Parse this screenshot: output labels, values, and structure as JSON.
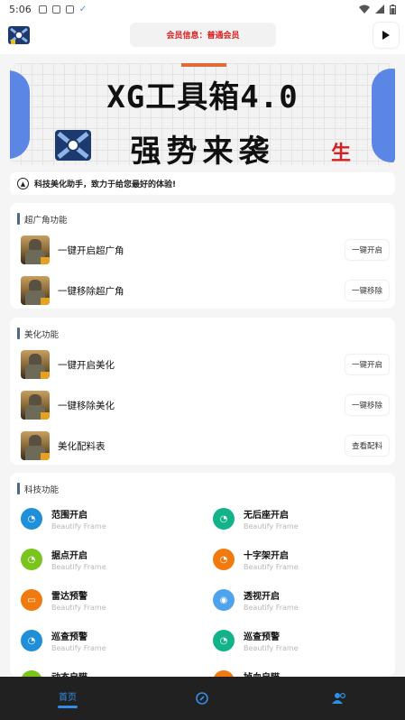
{
  "status_bar": {
    "time": "5:06"
  },
  "header": {
    "member_info": "会员信息：普通会员"
  },
  "banner": {
    "title": "XG工具箱4.0",
    "subtitle": "强势来袭",
    "corner_char": "生"
  },
  "notice": {
    "text": "科技美化助手，致力于给您最好的体验!"
  },
  "section1": {
    "title": "超广角功能",
    "rows": [
      {
        "label": "一键开启超广角",
        "action": "一键开启"
      },
      {
        "label": "一键移除超广角",
        "action": "一键移除"
      }
    ]
  },
  "section2": {
    "title": "美化功能",
    "rows": [
      {
        "label": "一键开启美化",
        "action": "一键开启"
      },
      {
        "label": "一键移除美化",
        "action": "一键移除"
      },
      {
        "label": "美化配料表",
        "action": "查看配料"
      }
    ]
  },
  "section3": {
    "title": "科技功能",
    "items": [
      {
        "name": "范围开启",
        "sub": "Beautify Frame",
        "color": "#1e8fd8",
        "icon": "gauge-icon"
      },
      {
        "name": "无后座开启",
        "sub": "Beautify Frame",
        "color": "#13b38a",
        "icon": "gauge-icon"
      },
      {
        "name": "据点开启",
        "sub": "Beautify Frame",
        "color": "#7ac41e",
        "icon": "gauge-icon"
      },
      {
        "name": "十字架开启",
        "sub": "Beautify Frame",
        "color": "#f07a10",
        "icon": "gauge-icon"
      },
      {
        "name": "雷达预警",
        "sub": "Beautify Frame",
        "color": "#f07a10",
        "icon": "vr-glasses-icon"
      },
      {
        "name": "透视开启",
        "sub": "Beautify Frame",
        "color": "#4fa3ea",
        "icon": "compass-icon"
      },
      {
        "name": "巡查预警",
        "sub": "Beautify Frame",
        "color": "#1e8fd8",
        "icon": "gauge-icon"
      },
      {
        "name": "巡查预警",
        "sub": "Beautify Frame",
        "color": "#13b38a",
        "icon": "gauge-icon"
      },
      {
        "name": "动态自瞄",
        "sub": "",
        "color": "#7ac41e",
        "icon": "gauge-icon"
      },
      {
        "name": "掉血自瞄",
        "sub": "",
        "color": "#f07a10",
        "icon": "gauge-icon"
      }
    ]
  },
  "tabbar": {
    "home_label": "首页",
    "accent": "#2f8fe8"
  }
}
